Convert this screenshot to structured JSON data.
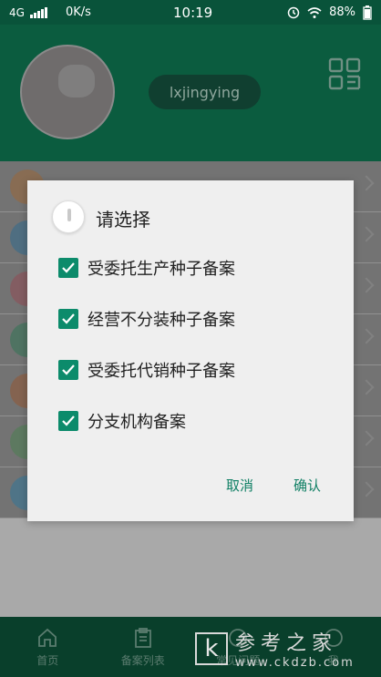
{
  "status_bar": {
    "network": "4G",
    "speed": "0K/s",
    "time": "10:19",
    "battery": "88%"
  },
  "profile": {
    "username": "lxjingying",
    "qr_icon": "qr-code-icon"
  },
  "list_rows": [
    {
      "icon": "circle-icon",
      "color": "#d2863a"
    },
    {
      "icon": "user-icon",
      "color": "#1e88c7"
    },
    {
      "icon": "target-icon",
      "color": "#d94c5d"
    },
    {
      "icon": "grid-icon",
      "color": "#1e8b5a"
    },
    {
      "icon": "edit-icon",
      "color": "#cf6a2a"
    },
    {
      "icon": "leaf-icon",
      "color": "#3f9c47"
    },
    {
      "icon": "doc-icon",
      "color": "#1f8fc5"
    }
  ],
  "dialog": {
    "title": "请选择",
    "options": [
      {
        "label": "受委托生产种子备案",
        "checked": true
      },
      {
        "label": "经营不分装种子备案",
        "checked": true
      },
      {
        "label": "受委托代销种子备案",
        "checked": true
      },
      {
        "label": "分支机构备案",
        "checked": true
      }
    ],
    "cancel": "取消",
    "confirm": "确认"
  },
  "bottom_nav": [
    {
      "label": "首页",
      "icon": "home-icon"
    },
    {
      "label": "备案列表",
      "icon": "clipboard-icon"
    },
    {
      "label": "常见问题",
      "icon": "question-icon"
    },
    {
      "label": "我",
      "icon": "user-icon"
    }
  ],
  "watermark": {
    "letter": "k",
    "text": "参考之家",
    "url": "www.ckdzb.com"
  },
  "colors": {
    "header_green": "#0b5c3f",
    "accent_green": "#0c8b6b"
  }
}
